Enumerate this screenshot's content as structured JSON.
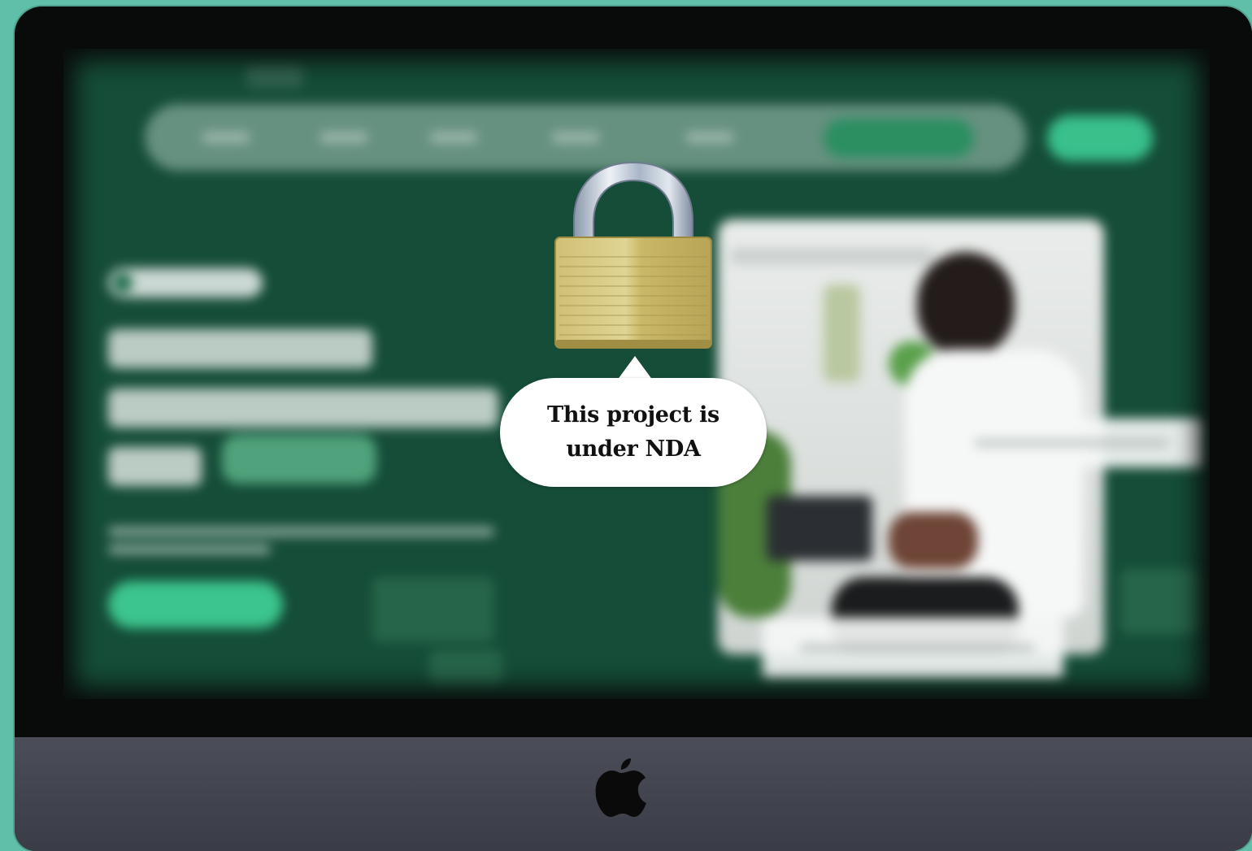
{
  "overlay": {
    "message": "This project is under NDA",
    "lock_icon": "padlock-icon"
  },
  "device": {
    "logo_icon": "apple-logo-icon"
  },
  "colors": {
    "background": "#5fbfa8",
    "screen": "#154d38",
    "accent": "#3cc58d",
    "chin": "#44464f"
  }
}
